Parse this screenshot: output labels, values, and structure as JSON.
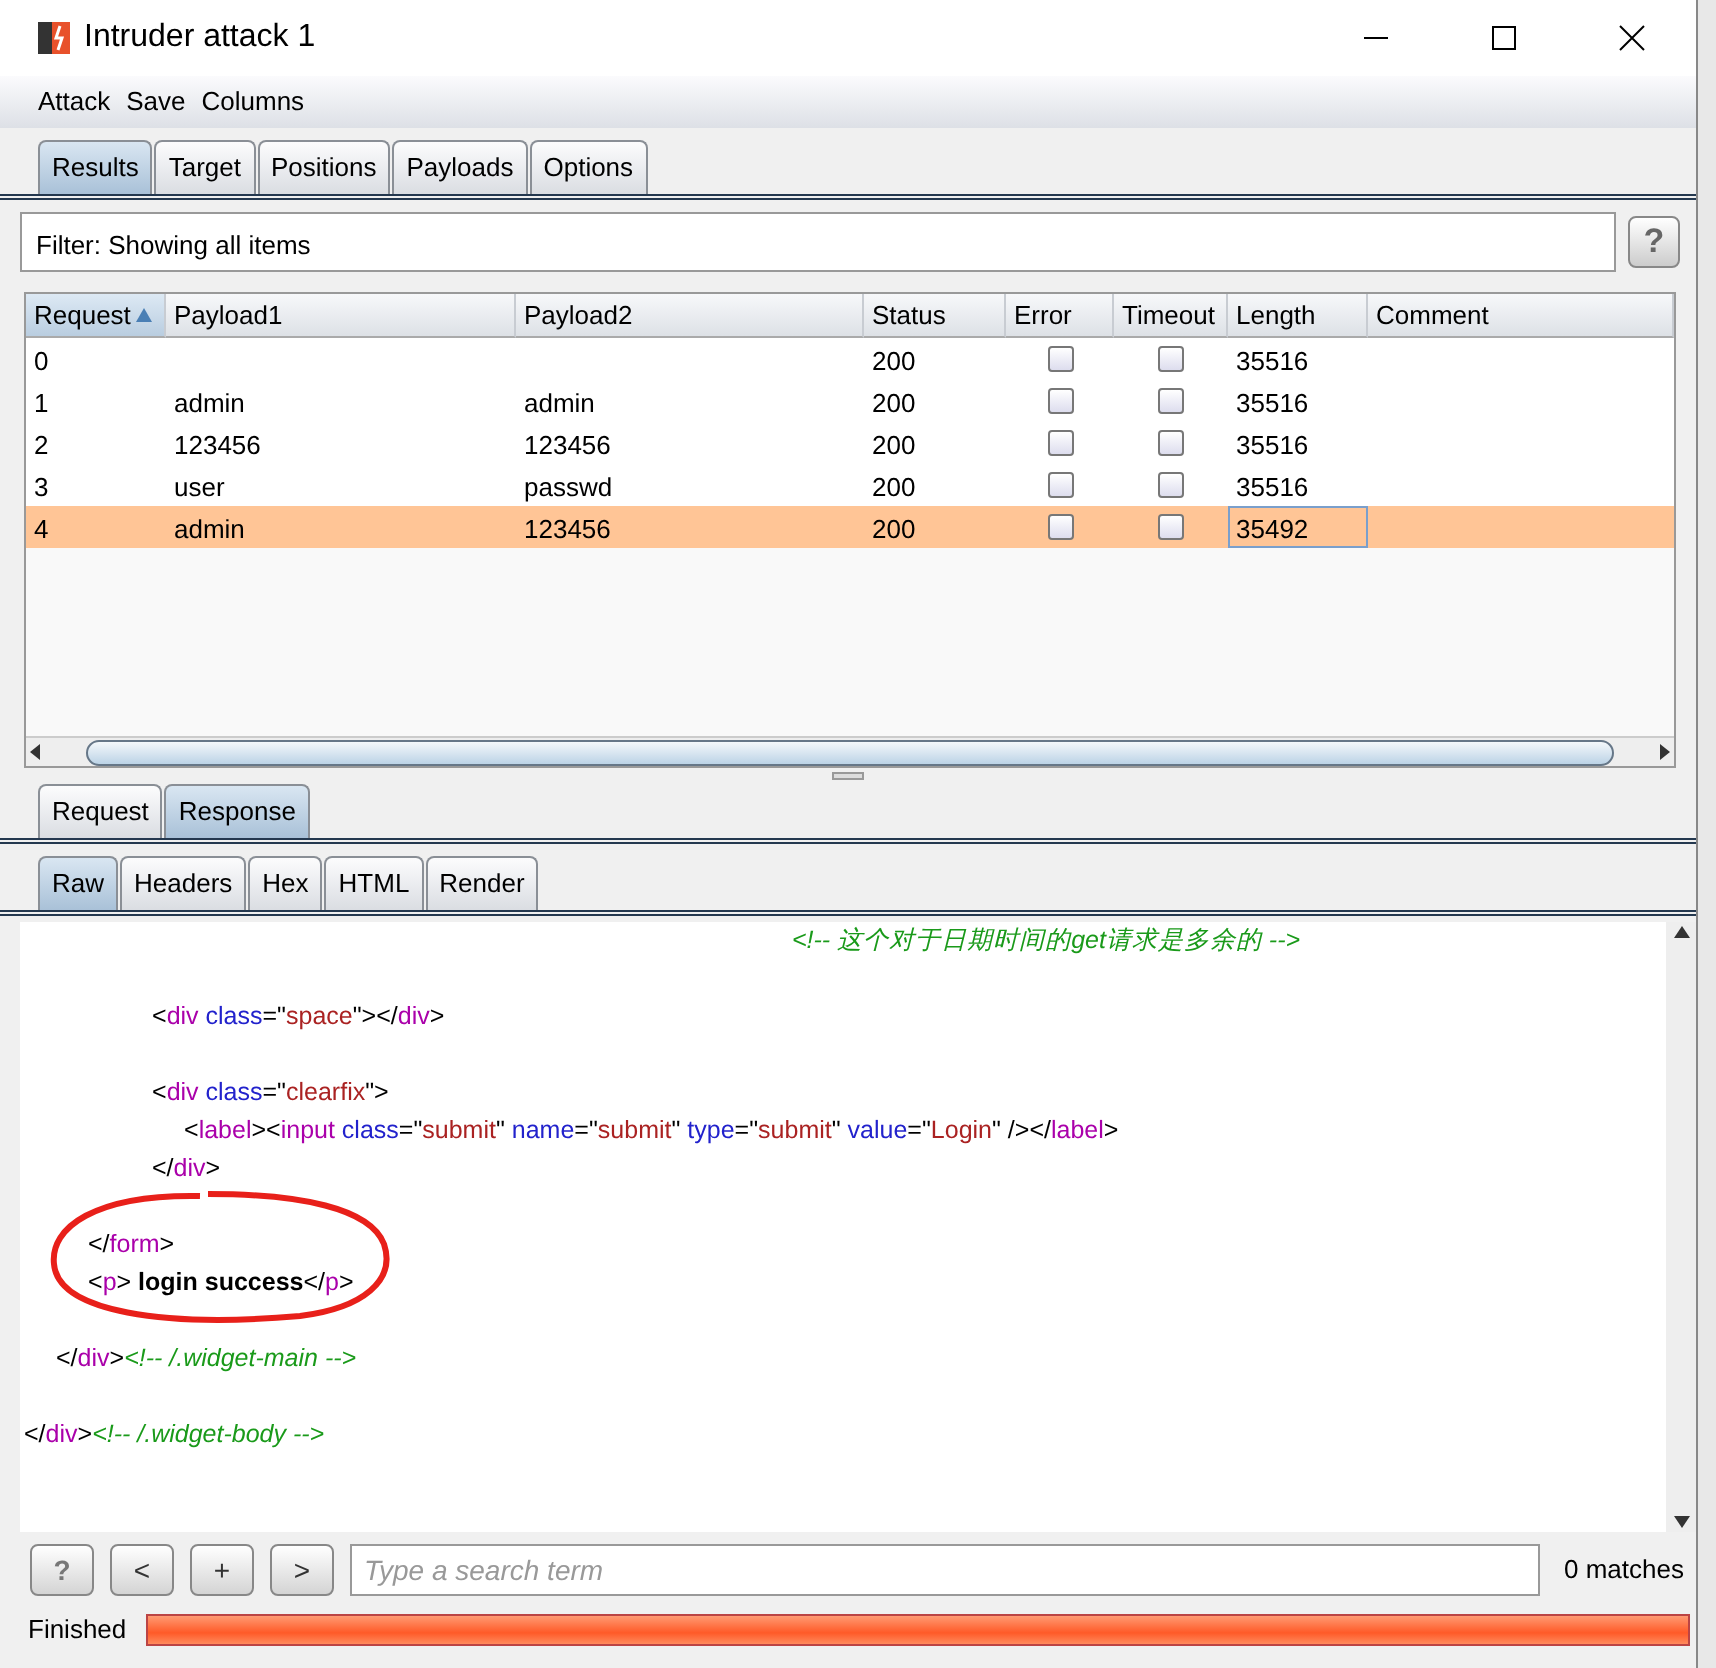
{
  "window": {
    "title": "Intruder attack 1"
  },
  "menu": [
    "Attack",
    "Save",
    "Columns"
  ],
  "tabs": [
    {
      "label": "Results",
      "selected": true
    },
    {
      "label": "Target",
      "selected": false
    },
    {
      "label": "Positions",
      "selected": false
    },
    {
      "label": "Payloads",
      "selected": false
    },
    {
      "label": "Options",
      "selected": false
    }
  ],
  "filter": {
    "text": "Filter: Showing all items",
    "help": "?"
  },
  "table": {
    "columns": [
      {
        "label": "Request",
        "sorted": true
      },
      {
        "label": "Payload1",
        "sorted": false
      },
      {
        "label": "Payload2",
        "sorted": false
      },
      {
        "label": "Status",
        "sorted": false
      },
      {
        "label": "Error",
        "sorted": false
      },
      {
        "label": "Timeout",
        "sorted": false
      },
      {
        "label": "Length",
        "sorted": false
      },
      {
        "label": "Comment",
        "sorted": false
      }
    ],
    "rows": [
      {
        "request": "0",
        "payload1": "",
        "payload2": "",
        "status": "200",
        "error": false,
        "timeout": false,
        "length": "35516",
        "selected": false
      },
      {
        "request": "1",
        "payload1": "admin",
        "payload2": "admin",
        "status": "200",
        "error": false,
        "timeout": false,
        "length": "35516",
        "selected": false
      },
      {
        "request": "2",
        "payload1": "123456",
        "payload2": "123456",
        "status": "200",
        "error": false,
        "timeout": false,
        "length": "35516",
        "selected": false
      },
      {
        "request": "3",
        "payload1": "user",
        "payload2": "passwd",
        "status": "200",
        "error": false,
        "timeout": false,
        "length": "35516",
        "selected": false
      },
      {
        "request": "4",
        "payload1": "admin",
        "payload2": "123456",
        "status": "200",
        "error": false,
        "timeout": false,
        "length": "35492",
        "selected": true
      }
    ]
  },
  "message_tabs": [
    {
      "label": "Request",
      "selected": false
    },
    {
      "label": "Response",
      "selected": true
    }
  ],
  "view_tabs": [
    {
      "label": "Raw",
      "selected": true
    },
    {
      "label": "Headers",
      "selected": false
    },
    {
      "label": "Hex",
      "selected": false
    },
    {
      "label": "HTML",
      "selected": false
    },
    {
      "label": "Render",
      "selected": false
    }
  ],
  "code_blocks": [
    [
      {
        "tokens": [
          {
            "kind": "comment",
            "text": "\t\t\t\t\t\t\t\t\t\t\t\t\t\t\t\t\t\t\t\t\t\t\t\t<!-- 这个对于日期时间的get请求是多余的 -->"
          }
        ]
      }
    ],
    [
      {
        "tokens": [
          {
            "kind": "plain",
            "text": "\t\t\t\t<"
          },
          {
            "kind": "tag",
            "text": "div"
          },
          {
            "kind": "attr",
            "text": " class"
          },
          {
            "kind": "plain",
            "text": "=\""
          },
          {
            "kind": "value",
            "text": "space"
          },
          {
            "kind": "plain",
            "text": "\"></"
          },
          {
            "kind": "tag",
            "text": "div"
          },
          {
            "kind": "plain",
            "text": ">"
          }
        ]
      }
    ],
    [
      {
        "tokens": [
          {
            "kind": "plain",
            "text": "\t\t\t\t<"
          },
          {
            "kind": "tag",
            "text": "div"
          },
          {
            "kind": "attr",
            "text": " class"
          },
          {
            "kind": "plain",
            "text": "=\""
          },
          {
            "kind": "value",
            "text": "clearfix"
          },
          {
            "kind": "plain",
            "text": "\">"
          }
        ]
      },
      {
        "tokens": [
          {
            "kind": "plain",
            "text": "\t\t\t\t\t<"
          },
          {
            "kind": "tag",
            "text": "label"
          },
          {
            "kind": "plain",
            "text": "><"
          },
          {
            "kind": "tag",
            "text": "input"
          },
          {
            "kind": "attr",
            "text": " class"
          },
          {
            "kind": "plain",
            "text": "=\""
          },
          {
            "kind": "value",
            "text": "submit"
          },
          {
            "kind": "plain",
            "text": "\""
          },
          {
            "kind": "attr",
            "text": " name"
          },
          {
            "kind": "plain",
            "text": "=\""
          },
          {
            "kind": "value",
            "text": "submit"
          },
          {
            "kind": "plain",
            "text": "\""
          },
          {
            "kind": "attr",
            "text": " type"
          },
          {
            "kind": "plain",
            "text": "=\""
          },
          {
            "kind": "value",
            "text": "submit"
          },
          {
            "kind": "plain",
            "text": "\""
          },
          {
            "kind": "attr",
            "text": " value"
          },
          {
            "kind": "plain",
            "text": "=\""
          },
          {
            "kind": "value",
            "text": "Login"
          },
          {
            "kind": "plain",
            "text": "\" /></"
          },
          {
            "kind": "tag",
            "text": "label"
          },
          {
            "kind": "plain",
            "text": ">"
          }
        ]
      },
      {
        "tokens": [
          {
            "kind": "plain",
            "text": "\t\t\t\t</"
          },
          {
            "kind": "tag",
            "text": "div"
          },
          {
            "kind": "plain",
            "text": ">"
          }
        ]
      }
    ],
    [
      {
        "tokens": [
          {
            "kind": "plain",
            "text": "\t\t</"
          },
          {
            "kind": "tag",
            "text": "form"
          },
          {
            "kind": "plain",
            "text": ">"
          }
        ]
      },
      {
        "tokens": [
          {
            "kind": "plain",
            "text": "\t\t<"
          },
          {
            "kind": "tag",
            "text": "p"
          },
          {
            "kind": "plain",
            "text": "> "
          },
          {
            "kind": "bold",
            "text": "login success"
          },
          {
            "kind": "plain",
            "text": "</"
          },
          {
            "kind": "tag",
            "text": "p"
          },
          {
            "kind": "plain",
            "text": ">"
          }
        ]
      }
    ],
    [
      {
        "tokens": [
          {
            "kind": "plain",
            "text": "\t</"
          },
          {
            "kind": "tag",
            "text": "div"
          },
          {
            "kind": "plain",
            "text": ">"
          },
          {
            "kind": "comment",
            "text": "<!-- /.widget-main -->"
          }
        ]
      }
    ],
    [
      {
        "tokens": [
          {
            "kind": "plain",
            "text": "</"
          },
          {
            "kind": "tag",
            "text": "div"
          },
          {
            "kind": "plain",
            "text": ">"
          },
          {
            "kind": "comment",
            "text": "<!-- /.widget-body -->"
          }
        ]
      }
    ]
  ],
  "search": {
    "buttons": [
      "?",
      "<",
      "+",
      ">"
    ],
    "placeholder": "Type a search term",
    "matches": "0 matches"
  },
  "status": {
    "text": "Finished",
    "level": 1.0
  }
}
